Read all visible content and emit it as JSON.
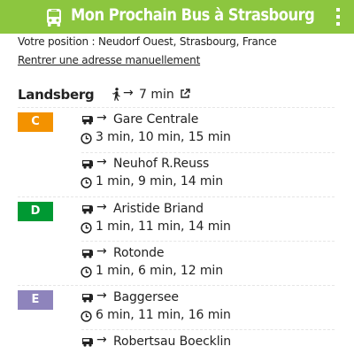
{
  "header": {
    "title": "Mon Prochain Bus à Strasbourg",
    "bus_icon": "bus-icon",
    "menu_icon": "kebab-menu-icon",
    "background_color": "#8cc63f"
  },
  "location": {
    "position_text": "Votre position : Neudorf Ouest, Strasbourg, France",
    "manual_link": "Rentrer une adresse manuellement"
  },
  "stop": {
    "name": "Landsberg",
    "walk_icon": "walking-icon",
    "walk_arrow": "→",
    "walk_time": "7 min",
    "external_icon": "external-link-icon"
  },
  "lines": [
    {
      "code": "C",
      "color": "#f39200",
      "directions": [
        {
          "destination": "Gare Centrale",
          "times": "3 min, 10 min, 15 min"
        },
        {
          "destination": "Neuhof R.Reuss",
          "times": "1 min, 9 min, 14 min"
        }
      ]
    },
    {
      "code": "D",
      "color": "#009933",
      "directions": [
        {
          "destination": "Aristide Briand",
          "times": "1 min, 11 min, 14 min"
        },
        {
          "destination": "Rotonde",
          "times": "1 min, 6 min, 12 min"
        }
      ]
    },
    {
      "code": "E",
      "color": "#8e84bc",
      "directions": [
        {
          "destination": "Baggersee",
          "times": "6 min, 11 min, 16 min"
        },
        {
          "destination": "Robertsau Boecklin",
          "times": ""
        }
      ]
    }
  ],
  "icons": {
    "bus_direction": "bus-icon",
    "arrow": "→",
    "clock": "clock-icon"
  }
}
